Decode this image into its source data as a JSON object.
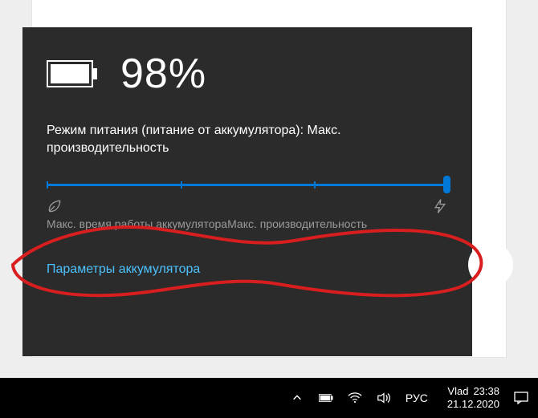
{
  "battery": {
    "percentage": "98%",
    "mode_line": "Режим питания (питание от аккумулятора): Макс. производительность",
    "slider_value": 100,
    "label_left": "Макс. время работы аккумулятора",
    "label_right": "Макс. производительность",
    "settings_link": "Параметры аккумулятора"
  },
  "taskbar": {
    "language": "РУС",
    "user": "Vlad",
    "time": "23:38",
    "date": "21.12.2020"
  },
  "colors": {
    "accent": "#0078d7",
    "link": "#4cc2ff",
    "flyout_bg": "#2b2b2b"
  }
}
